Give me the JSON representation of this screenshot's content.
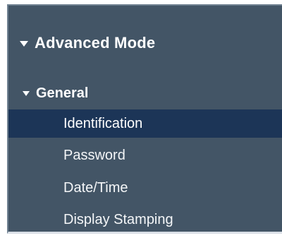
{
  "menu": {
    "mode": {
      "label": "Advanced Mode",
      "expanded": true,
      "icon": "caret-down-icon"
    },
    "group": {
      "label": "General",
      "expanded": true,
      "icon": "caret-down-icon"
    },
    "items": [
      {
        "label": "Identification",
        "selected": true
      },
      {
        "label": "Password",
        "selected": false
      },
      {
        "label": "Date/Time",
        "selected": false
      },
      {
        "label": "Display Stamping",
        "selected": false
      }
    ]
  },
  "colors": {
    "panel_background": "#435566",
    "selected_background": "#1c3557",
    "text": "#ffffff"
  }
}
